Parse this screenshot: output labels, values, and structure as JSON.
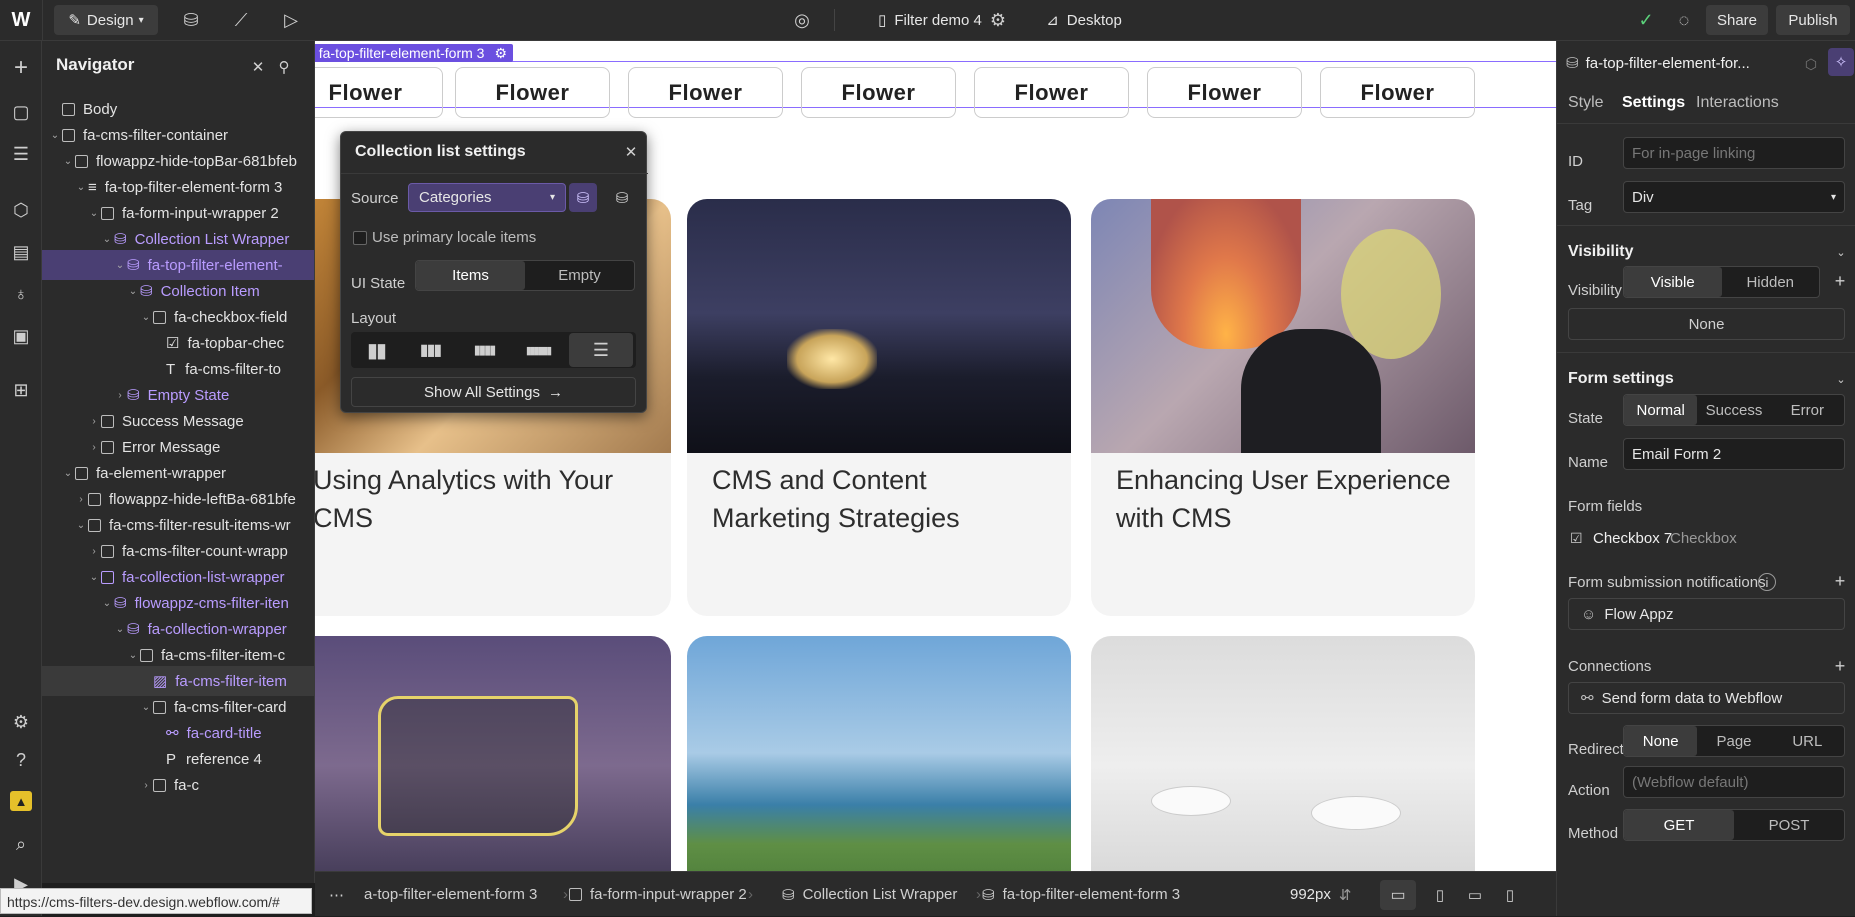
{
  "topbar": {
    "mode_label": "Design",
    "page_name": "Filter demo 4",
    "breakpoint_label": "Desktop",
    "share_label": "Share",
    "publish_label": "Publish"
  },
  "navigator": {
    "title": "Navigator",
    "items": [
      {
        "label": "Body"
      },
      {
        "label": "fa-cms-filter-container"
      },
      {
        "label": "flowappz-hide-topBar-681bfeb"
      },
      {
        "label": "fa-top-filter-element-form 3"
      },
      {
        "label": "fa-form-input-wrapper 2"
      },
      {
        "label": "Collection List Wrapper"
      },
      {
        "label": "fa-top-filter-element-"
      },
      {
        "label": "Collection Item"
      },
      {
        "label": "fa-checkbox-field"
      },
      {
        "label": "fa-topbar-chec"
      },
      {
        "label": "fa-cms-filter-to"
      },
      {
        "label": "Empty State"
      },
      {
        "label": "Success Message"
      },
      {
        "label": "Error Message"
      },
      {
        "label": "fa-element-wrapper"
      },
      {
        "label": "flowappz-hide-leftBa-681bfe"
      },
      {
        "label": "fa-cms-filter-result-items-wr"
      },
      {
        "label": "fa-cms-filter-count-wrapp"
      },
      {
        "label": "fa-collection-list-wrapper"
      },
      {
        "label": "flowappz-cms-filter-iten"
      },
      {
        "label": "fa-collection-wrapper"
      },
      {
        "label": "fa-cms-filter-item-c"
      },
      {
        "label": "fa-cms-filter-item"
      },
      {
        "label": "fa-cms-filter-card"
      },
      {
        "label": "fa-card-title"
      },
      {
        "label": "reference 4"
      },
      {
        "label": "fa-c"
      }
    ]
  },
  "canvas": {
    "selected_tag": "fa-top-filter-element-form 3",
    "filter_buttons": [
      "Flower",
      "Flower",
      "Flower",
      "Flower",
      "Flower",
      "Flower",
      "Flower"
    ],
    "cards": [
      {
        "title": "Using Analytics with Your CMS"
      },
      {
        "title": "CMS and Content Marketing Strategies"
      },
      {
        "title": "Enhancing User Experience with CMS"
      }
    ]
  },
  "popup": {
    "title": "Collection list settings",
    "source_label": "Source",
    "source_value": "Categories",
    "primary_locale_label": "Use primary locale items",
    "ui_state_label": "UI State",
    "ui_state_options": [
      "Items",
      "Empty"
    ],
    "layout_label": "Layout",
    "show_all_label": "Show All Settings"
  },
  "bottombar": {
    "breadcrumbs": [
      "a-top-filter-element-form 3",
      "fa-form-input-wrapper 2",
      "Collection List Wrapper",
      "fa-top-filter-element-form 3"
    ],
    "width_value": "992px"
  },
  "statusbar": {
    "url": "https://cms-filters-dev.design.webflow.com/#"
  },
  "right_panel": {
    "element_name": "fa-top-filter-element-for...",
    "tabs": [
      "Style",
      "Settings",
      "Interactions"
    ],
    "id_label": "ID",
    "id_placeholder": "For in-page linking",
    "tag_label": "Tag",
    "tag_value": "Div",
    "visibility_title": "Visibility",
    "visibility_label": "Visibility",
    "visibility_options": [
      "Visible",
      "Hidden"
    ],
    "visibility_none": "None",
    "form_settings_title": "Form settings",
    "state_label": "State",
    "state_options": [
      "Normal",
      "Success",
      "Error"
    ],
    "name_label": "Name",
    "name_value": "Email Form 2",
    "form_fields_label": "Form fields",
    "field_name": "Checkbox 7",
    "field_type": "Checkbox",
    "notifications_label": "Form submission notifications",
    "notify_user": "Flow Appz",
    "connections_label": "Connections",
    "send_form_label": "Send form data to Webflow",
    "redirect_label": "Redirect",
    "redirect_options": [
      "None",
      "Page",
      "URL"
    ],
    "action_label": "Action",
    "action_placeholder": "(Webflow default)",
    "method_label": "Method",
    "method_options": [
      "GET",
      "POST"
    ]
  }
}
